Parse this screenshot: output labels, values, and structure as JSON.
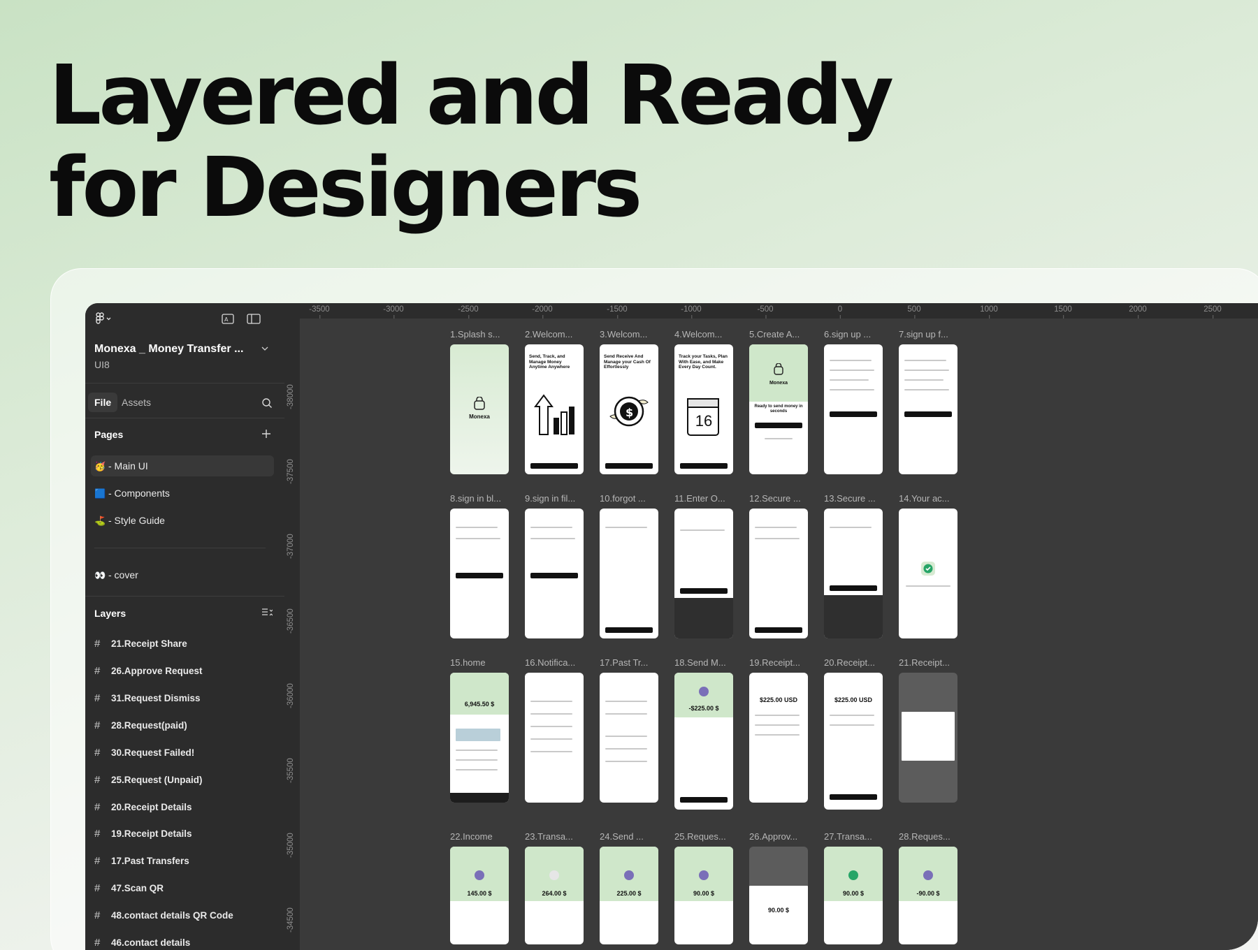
{
  "headline": {
    "line1": "Layered and Ready",
    "line2": "for Designers"
  },
  "sidebar": {
    "project_name": "Monexa _ Money Transfer ...",
    "team": "UI8",
    "tabs": {
      "file": "File",
      "assets": "Assets"
    },
    "pages_title": "Pages",
    "pages": [
      {
        "emoji": "🥳",
        "label": "- Main UI"
      },
      {
        "emoji": "🟦",
        "label": "- Components"
      },
      {
        "emoji": "⛳",
        "label": "- Style Guide"
      },
      {
        "emoji": "👀",
        "label": "- cover"
      }
    ],
    "layers_title": "Layers",
    "layers": [
      "21.Receipt Share",
      "26.Approve Request",
      "31.Request Dismiss",
      "28.Request(paid)",
      "30.Request Failed!",
      "25.Request (Unpaid)",
      "20.Receipt Details",
      "19.Receipt Details",
      "17.Past Transfers",
      "47.Scan QR",
      "48.contact details QR Code",
      "46.contact details"
    ]
  },
  "ruler": {
    "top": [
      "-3500",
      "-3000",
      "-2500",
      "-2000",
      "-1500",
      "-1000",
      "-500",
      "0",
      "500",
      "1000",
      "1500",
      "2000",
      "2500"
    ],
    "left": [
      "-38000",
      "-37500",
      "-37000",
      "-36500",
      "-36000",
      "-35500",
      "-35000",
      "-34500"
    ]
  },
  "frames": {
    "row1": [
      "1.Splash s...",
      "2.Welcom...",
      "3.Welcom...",
      "4.Welcom...",
      "5.Create A...",
      "6.sign up ...",
      "7.sign up f..."
    ],
    "row2": [
      "8.sign in bl...",
      "9.sign in fil...",
      "10.forgot ...",
      "11.Enter O...",
      "12.Secure ...",
      "13.Secure ...",
      "14.Your ac..."
    ],
    "row3": [
      "15.home",
      "16.Notifica...",
      "17.Past Tr...",
      "18.Send M...",
      "19.Receipt...",
      "20.Receipt...",
      "21.Receipt..."
    ],
    "row4": [
      "22.Income",
      "23.Transa...",
      "24.Send ...",
      "25.Reques...",
      "26.Approv...",
      "27.Transa...",
      "28.Reques..."
    ]
  },
  "screens": {
    "splash_brand": "Monexa",
    "welcome2": "Send, Track, and Manage Money Anytime Anywhere",
    "welcome3": "Send Receive And Manage your Cash Of Effortlessly",
    "welcome4": "Track your Tasks, Plan With Ease, and Make Every Day Count.",
    "calendar_day": "16",
    "create_brand": "Monexa",
    "create_tagline": "Ready to send money in seconds",
    "home_balance": "6,945.50 $",
    "send_amount": "-$225.00 $",
    "receipt19": "$225.00 USD",
    "receipt20": "$225.00 USD",
    "income": "145.00 $",
    "transa23": "264.00 $",
    "send24": "225.00 $",
    "request25": "90.00 $",
    "approve26": "90.00 $",
    "transa27": "90.00 $",
    "request28": "-90.00 $"
  },
  "colors": {
    "accent_green": "#cfe7ca",
    "sidebar_bg": "#2c2c2c",
    "canvas_bg": "#3a3a3a"
  }
}
